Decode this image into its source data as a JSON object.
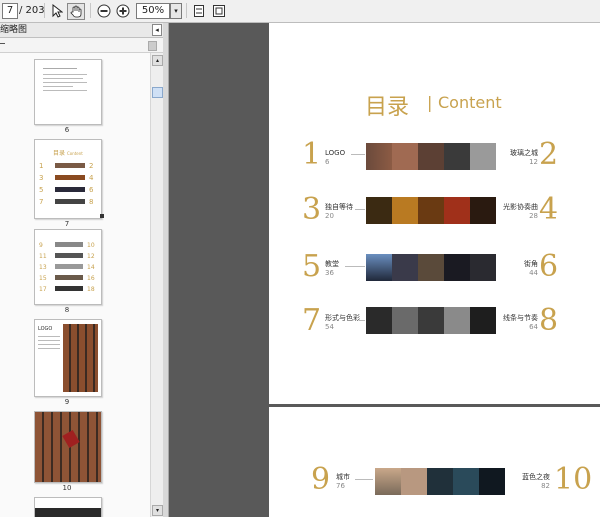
{
  "toolbar": {
    "page_current": "7",
    "page_total": "/ 203",
    "zoom": "50%",
    "zoom_drop": "▾",
    "icons": [
      "select-arrow-icon",
      "hand-tool-icon",
      "zoom-out-icon",
      "zoom-in-icon",
      "fit-page-icon",
      "fit-width-icon"
    ]
  },
  "panel": {
    "title": "缩略图",
    "collapse": "◂",
    "thumbnails": [
      "6",
      "7",
      "8",
      "9",
      "10"
    ]
  },
  "page": {
    "title_cn": "目录",
    "title_sep": "|",
    "title_en": "Content",
    "entries": [
      {
        "num": "1",
        "label": "LOGO",
        "page": "6"
      },
      {
        "num": "2",
        "label": "玻璃之城",
        "page": "12"
      },
      {
        "num": "3",
        "label": "独自等待",
        "page": "20"
      },
      {
        "num": "4",
        "label": "光影协奏曲",
        "page": "28"
      },
      {
        "num": "5",
        "label": "教堂",
        "page": "36"
      },
      {
        "num": "6",
        "label": "街角",
        "page": "44"
      },
      {
        "num": "7",
        "label": "形式与色彩",
        "page": "54"
      },
      {
        "num": "8",
        "label": "线条与节奏",
        "page": "64"
      },
      {
        "num": "9",
        "label": "城市",
        "page": "76"
      },
      {
        "num": "10",
        "label": "蓝色之夜",
        "page": "82"
      }
    ]
  },
  "thumb_text": {
    "toc_title": "目录",
    "toc_en": "Content",
    "logo": "LOGO",
    "nums_left_7": [
      "1",
      "3",
      "5",
      "7"
    ],
    "nums_right_7": [
      "2",
      "4",
      "6",
      "8"
    ],
    "nums_left_8": [
      "9",
      "11",
      "13",
      "15",
      "17"
    ],
    "nums_right_8": [
      "10",
      "12",
      "14",
      "16",
      "18"
    ]
  },
  "colors": {
    "accent": "#c8a24e",
    "viewer_bg": "#595959"
  }
}
